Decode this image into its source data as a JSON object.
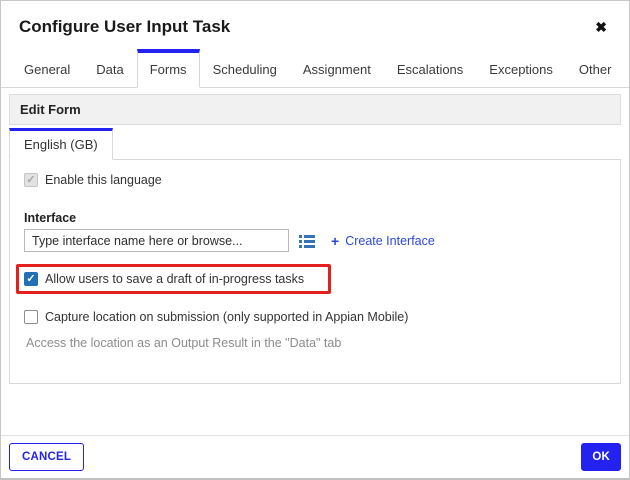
{
  "dialog": {
    "title": "Configure User Input Task",
    "close_icon": "✖"
  },
  "tabs": [
    {
      "label": "General",
      "active": false
    },
    {
      "label": "Data",
      "active": false
    },
    {
      "label": "Forms",
      "active": true
    },
    {
      "label": "Scheduling",
      "active": false
    },
    {
      "label": "Assignment",
      "active": false
    },
    {
      "label": "Escalations",
      "active": false
    },
    {
      "label": "Exceptions",
      "active": false
    },
    {
      "label": "Other",
      "active": false
    }
  ],
  "form_section": {
    "header": "Edit Form",
    "language_tab": "English (GB)",
    "enable_language": {
      "label": "Enable this language",
      "checked": true,
      "disabled": true
    },
    "interface": {
      "label": "Interface",
      "placeholder": "Type interface name here or browse...",
      "value": "",
      "browse_icon": "list-icon",
      "plus_icon": "+",
      "create_link": "Create Interface"
    },
    "draft_checkbox": {
      "label": "Allow users to save a draft of in-progress tasks",
      "checked": true,
      "highlighted": true
    },
    "location_checkbox": {
      "label": "Capture location on submission (only supported in Appian Mobile)",
      "checked": false
    },
    "location_help": "Access the location as an Output Result in the \"Data\" tab"
  },
  "footer": {
    "cancel_label": "CANCEL",
    "ok_label": "OK"
  },
  "colors": {
    "accent": "#2322f0",
    "link": "#2d49d6",
    "checkbox_checked": "#2170b4",
    "highlight_red": "#e3201c"
  }
}
